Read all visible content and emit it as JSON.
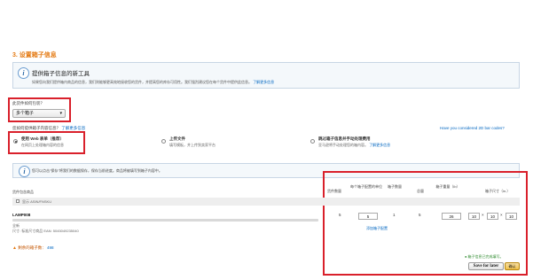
{
  "section_title": "3. 设置箱子信息",
  "info": {
    "title": "提供箱子信息的新工具",
    "description": "如果您向我们提供箱内商品的信息，我们则能够更高效地接收您的货件，并提高您的库存可用性。我们强烈建议您在每个货件中提供此信息。",
    "link": "了解更多信息"
  },
  "packing": {
    "question": "此货件如何包装？",
    "selected": "多个箱子",
    "prompt": "您如何提供箱子内容信息？",
    "prompt_link": "了解更多信息",
    "side_link": "Have you considered 2D bar codes?"
  },
  "options": [
    {
      "title": "使用 Web 表单（推荐）",
      "subtitle": "在网页上处理箱内容的信息",
      "selected": true
    },
    {
      "title": "上传文件",
      "subtitle": "填写模板，并上传到卖家平台",
      "selected": false
    },
    {
      "title": "跳过箱子信息并手动处理费用",
      "subtitle": "亚马逊将手动处理您的箱内容。",
      "link": "了解更多信息",
      "selected": false
    }
  ],
  "hint": "您可以点击\"保存\"将我们的数据保存，保存当前进度。商品将被填写到箱子内容中。",
  "table": {
    "left_header": "货件包含商品",
    "headers": [
      "货件数量",
      "每个箱子配置的单位",
      "箱子数量",
      "总量",
      "箱子重量（lb）",
      "箱子尺寸（in.）"
    ],
    "group_label": "显示 ASIN/FNSKU",
    "product": {
      "sku": "LAMP008",
      "condition": "全新",
      "identifier": "尺寸: 标准尺寸商品 EAN: 5045049235040",
      "units_quantity": "5",
      "units_per_box": "5",
      "box_count": "1",
      "total": "5",
      "weight": "26",
      "dim_l": "10",
      "dim_w": "10",
      "dim_h": "10",
      "times_sign": "×",
      "add_config": "添加箱子配置"
    }
  },
  "remaining": {
    "label": "剩余的箱子数：",
    "value": "498"
  },
  "status": "箱子信息已完成填写。",
  "buttons": {
    "save": "Save for later",
    "confirm": "确认"
  }
}
